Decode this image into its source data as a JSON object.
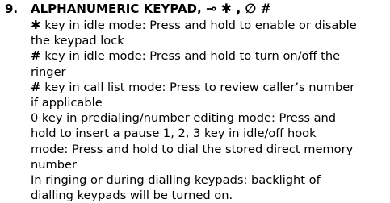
{
  "section": {
    "number": "9.",
    "title": "ALPHANUMERIC KEYPAD,",
    "symbols": [
      "⊸",
      "✱",
      ",",
      "∅",
      "#"
    ]
  },
  "body_lines": [
    {
      "glyph": "✱",
      "text": " key in idle mode: Press and hold to enable or disable"
    },
    {
      "glyph": "",
      "text": "the keypad lock"
    },
    {
      "glyph": "#",
      "text": " key in idle mode: Press and hold to turn on/off the"
    },
    {
      "glyph": "",
      "text": "ringer"
    },
    {
      "glyph": "#",
      "text": " key in call list mode: Press to review caller’s number"
    },
    {
      "glyph": "",
      "text": "if applicable"
    },
    {
      "glyph": "",
      "text": "0 key in predialing/number editing mode: Press and"
    },
    {
      "glyph": "",
      "text": "hold to insert a pause 1, 2, 3 key in idle/off hook"
    },
    {
      "glyph": "",
      "text": "mode: Press and hold to dial the stored direct memory"
    },
    {
      "glyph": "",
      "text": "number"
    },
    {
      "glyph": "",
      "text": "In ringing or during dialling keypads: backlight of"
    },
    {
      "glyph": "",
      "text": "dialling keypads will be turned on."
    }
  ]
}
